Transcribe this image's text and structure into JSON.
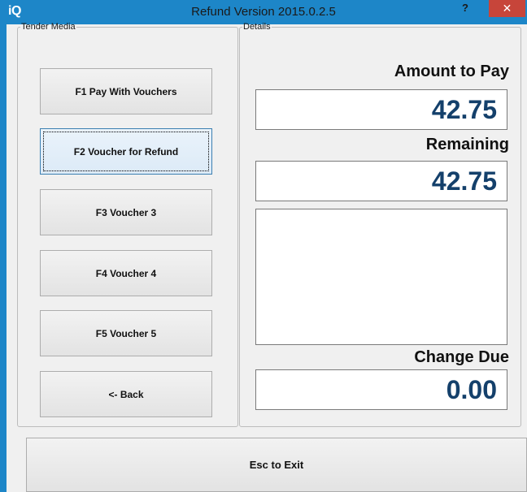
{
  "window": {
    "icon_text": "iQ",
    "title": "Refund Version 2015.0.2.5",
    "help_label": "?",
    "close_label": "✕"
  },
  "tender_media": {
    "legend": "Tender Media",
    "buttons": [
      {
        "label": "F1 Pay With Vouchers"
      },
      {
        "label": "F2 Voucher for Refund"
      },
      {
        "label": "F3 Voucher 3"
      },
      {
        "label": "F4 Voucher 4"
      },
      {
        "label": "F5 Voucher 5"
      },
      {
        "label": "<- Back"
      }
    ]
  },
  "details": {
    "legend": "Details",
    "amount_to_pay_label": "Amount to Pay",
    "amount_to_pay_value": "42.75",
    "remaining_label": "Remaining",
    "remaining_value": "42.75",
    "change_due_label": "Change Due",
    "change_due_value": "0.00"
  },
  "footer": {
    "exit_label": "Esc to Exit"
  }
}
